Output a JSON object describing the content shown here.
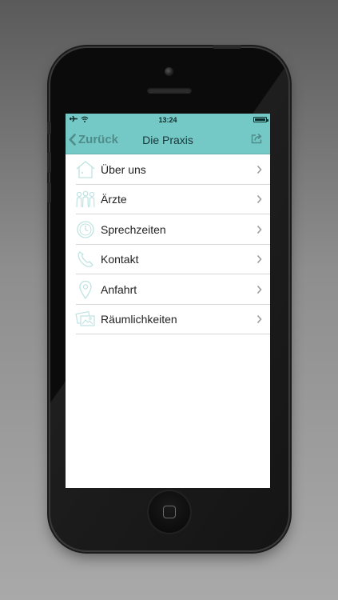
{
  "status": {
    "time": "13:24"
  },
  "navbar": {
    "back_label": "Zurück",
    "title": "Die Praxis"
  },
  "menu": [
    {
      "label": "Über uns",
      "icon": "house-icon"
    },
    {
      "label": "Ärzte",
      "icon": "doctors-icon"
    },
    {
      "label": "Sprechzeiten",
      "icon": "clock-icon"
    },
    {
      "label": "Kontakt",
      "icon": "phone-icon"
    },
    {
      "label": "Anfahrt",
      "icon": "location-pin-icon"
    },
    {
      "label": "Räumlichkeiten",
      "icon": "photos-icon"
    }
  ],
  "colors": {
    "accent": "#74c9c6",
    "icon": "#bfe3e2",
    "back": "#4f8c8a"
  }
}
